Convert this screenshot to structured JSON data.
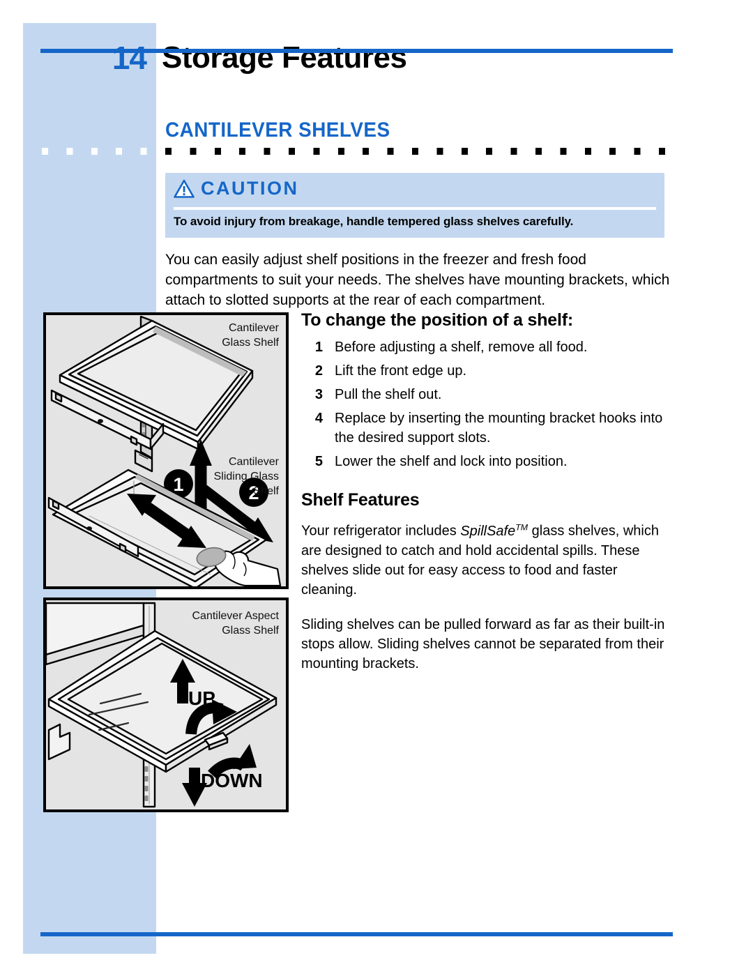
{
  "theme": {
    "accent_blue": "#1566c8",
    "band_blue": "#c3d8f0",
    "figure_gray": "#e4e4e4",
    "text_black": "#000000"
  },
  "header": {
    "page_number": "14",
    "title": "Storage Features"
  },
  "section": {
    "heading": "CANTILEVER SHELVES"
  },
  "caution": {
    "label": "CAUTION",
    "icon": "warning-triangle-icon",
    "text": "To avoid  injury from breakage, handle tempered glass shelves carefully."
  },
  "intro": {
    "paragraph": "You can easily adjust shelf positions in the freezer and fresh food compartments to suit your needs. The shelves have mounting brackets, which attach to slotted supports at the rear of each compartment."
  },
  "procedure": {
    "heading": "To change the position of a shelf:",
    "steps": [
      {
        "num": "1",
        "text": "Before adjusting a shelf, remove all food."
      },
      {
        "num": "2",
        "text": "Lift the front edge up."
      },
      {
        "num": "3",
        "text": "Pull the shelf out."
      },
      {
        "num": "4",
        "text": "Replace by inserting the mounting bracket hooks into the desired support slots."
      },
      {
        "num": "5",
        "text": "Lower the shelf and lock into position."
      }
    ]
  },
  "shelf_features": {
    "heading": "Shelf Features",
    "paragraph_1_before": "Your refrigerator includes ",
    "trademark_name": "SpillSafe",
    "trademark_mark": "TM",
    "paragraph_1_after": " glass shelves, which are designed to catch and hold accidental spills. These shelves slide out for easy access to food and faster cleaning.",
    "paragraph_2": "Sliding shelves can be pulled forward as far as their built-in stops allow. Sliding shelves cannot be separated from their mounting brackets."
  },
  "figures": {
    "top": {
      "caption_cantilever": "Cantilever\nGlass Shelf",
      "caption_sliding": "Cantilever\nSliding Glass\nShelf",
      "callout_1": "1",
      "callout_2": "2"
    },
    "bottom": {
      "caption_aspect": "Cantilever Aspect\nGlass Shelf",
      "label_up": "UP",
      "label_down": "DOWN"
    }
  }
}
